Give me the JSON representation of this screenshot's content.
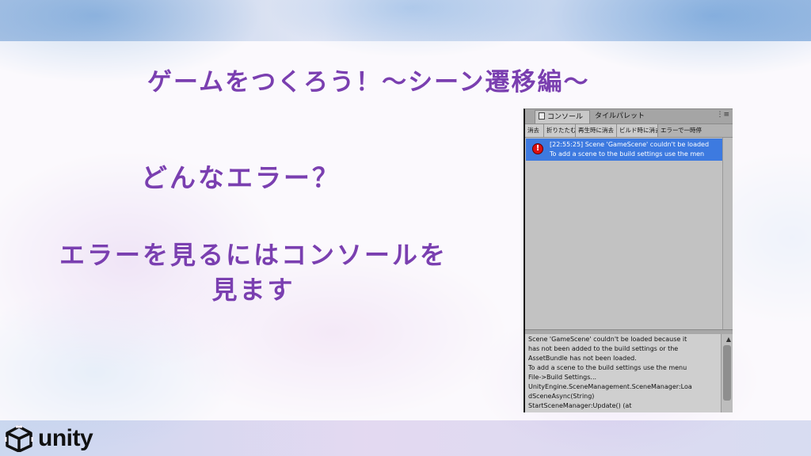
{
  "slide": {
    "title": "ゲームをつくろう！〜シーン遷移編〜",
    "question": "どんなエラー？",
    "desc_line1": "エラーを見るにはコンソールを",
    "desc_line2": "見ます"
  },
  "logo": {
    "text": "unity",
    "icon": "unity-cube-icon"
  },
  "console": {
    "tabs": [
      {
        "label": "コンソール",
        "icon": "console-tab-icon"
      },
      {
        "label": "タイルパレット"
      }
    ],
    "menu_icon": "⋮≡",
    "toolbar": [
      "消去",
      "折りたたむ",
      "再生時に消去",
      "ビルド時に消去",
      "エラーで一時停"
    ],
    "log_entry": {
      "icon": "error-icon",
      "line1": "[22:55:25] Scene 'GameScene' couldn't be loaded",
      "line2": "To add a scene to the build settings use the men"
    },
    "detail_lines": [
      "Scene 'GameScene' couldn't be loaded because it",
      "has not been added to the build settings or the",
      "AssetBundle has not been loaded.",
      "To add a scene to the build settings use the menu",
      "File->Build Settings...",
      "UnityEngine.SceneManagement.SceneManager:Loa",
      "dSceneAsync(String)",
      "StartSceneManager:Update() (at"
    ]
  }
}
